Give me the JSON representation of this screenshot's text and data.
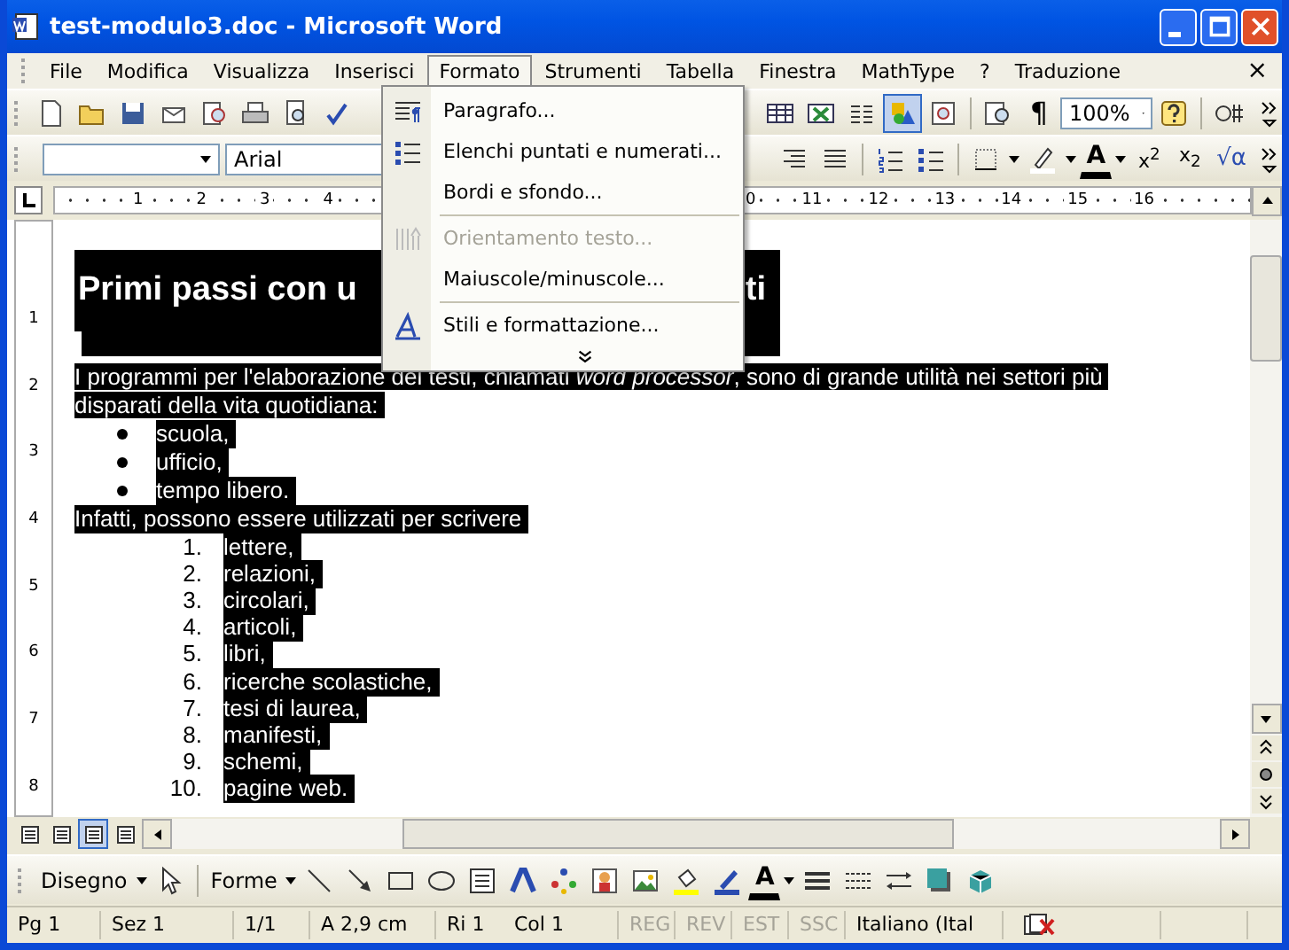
{
  "window": {
    "title": "test-modulo3.doc - Microsoft Word"
  },
  "menu_bar": {
    "items": [
      {
        "label": "File",
        "selected": false
      },
      {
        "label": "Modifica",
        "selected": false
      },
      {
        "label": "Visualizza",
        "selected": false
      },
      {
        "label": "Inserisci",
        "selected": false
      },
      {
        "label": "Formato",
        "selected": true
      },
      {
        "label": "Strumenti",
        "selected": false
      },
      {
        "label": "Tabella",
        "selected": false
      },
      {
        "label": "Finestra",
        "selected": false
      },
      {
        "label": "MathType",
        "selected": false
      },
      {
        "label": "?",
        "selected": false
      },
      {
        "label": "Traduzione",
        "selected": false
      }
    ],
    "close": "×"
  },
  "standard_toolbar": {
    "right": [
      {
        "pressed": false
      },
      {
        "pressed": false
      },
      {
        "pressed": false
      },
      {
        "pressed": true
      },
      {
        "pressed": false
      }
    ],
    "show_marks": "¶",
    "zoom": "100%"
  },
  "formatting_toolbar": {
    "font": "Arial",
    "font_color": "A",
    "superscript": "x$^{2}$",
    "subscript": "x$_{2}$",
    "equation": "√α"
  },
  "ruler": {
    "left_labels": [
      "1",
      "2",
      "3",
      "4"
    ],
    "right_labels": [
      "0",
      "11",
      "12",
      "13",
      "14",
      "15",
      "16"
    ]
  },
  "vertical_ruler": {
    "labels": [
      "1",
      "2",
      "3",
      "4",
      "5",
      "6",
      "7",
      "8"
    ]
  },
  "format_menu": {
    "items": [
      {
        "label": "Paragrafo...",
        "kind": "paragraph",
        "disabled": false,
        "separator_before": false
      },
      {
        "label": "Elenchi puntati e numerati...",
        "kind": "list",
        "disabled": false,
        "separator_before": false
      },
      {
        "label": "Bordi e sfondo...",
        "kind": "plain",
        "disabled": false,
        "separator_before": false
      },
      {
        "label": "Orientamento testo...",
        "kind": "direction",
        "disabled": true,
        "separator_before": true
      },
      {
        "label": "Maiuscole/minuscole...",
        "kind": "plain",
        "disabled": false,
        "separator_before": false
      },
      {
        "label": "Stili e formattazione...",
        "kind": "styles",
        "disabled": false,
        "separator_before": true
      }
    ]
  },
  "document": {
    "heading_left": "Primi passi con u",
    "heading_right": "ti",
    "paragraph": "I programmi per l'elaborazione dei testi, chiamati *word processor*, sono di grande utilità nei settori più disparati della vita quotidiana:",
    "bullets": [
      "scuola,",
      "ufficio,",
      "tempo libero."
    ],
    "intro": "Infatti, possono essere utilizzati per scrivere",
    "numbered": [
      {
        "number": "1.",
        "text": "lettere,"
      },
      {
        "number": "2.",
        "text": "relazioni,"
      },
      {
        "number": "3.",
        "text": "circolari,"
      },
      {
        "number": "4.",
        "text": "articoli,"
      },
      {
        "number": "5.",
        "text": "libri,"
      },
      {
        "number": "6.",
        "text": "ricerche scolastiche,"
      },
      {
        "number": "7.",
        "text": "tesi di laurea,"
      },
      {
        "number": "8.",
        "text": "manifesti,"
      },
      {
        "number": "9.",
        "text": "schemi,"
      },
      {
        "number": "10.",
        "text": "pagine web."
      }
    ]
  },
  "view_buttons": [
    {
      "selected": false
    },
    {
      "selected": false
    },
    {
      "selected": true
    },
    {
      "selected": false
    }
  ],
  "drawing_toolbar": {
    "draw": "Disegno",
    "shapes": "Forme",
    "font_color": "A"
  },
  "status_bar": {
    "fields": [
      {
        "text": "Pg 1",
        "disabled": false
      },
      {
        "text": "Sez 1",
        "disabled": false
      },
      {
        "text": "1/1",
        "disabled": false
      },
      {
        "text": "A 2,9 cm",
        "disabled": false
      },
      {
        "text": "Ri 1",
        "disabled": false
      },
      {
        "text": "Col 1",
        "disabled": false
      },
      {
        "text": "REG",
        "disabled": true
      },
      {
        "text": "REV",
        "disabled": true
      },
      {
        "text": "EST",
        "disabled": true
      },
      {
        "text": "SSC",
        "disabled": true
      },
      {
        "text": "Italiano (Ital",
        "disabled": false
      }
    ]
  }
}
